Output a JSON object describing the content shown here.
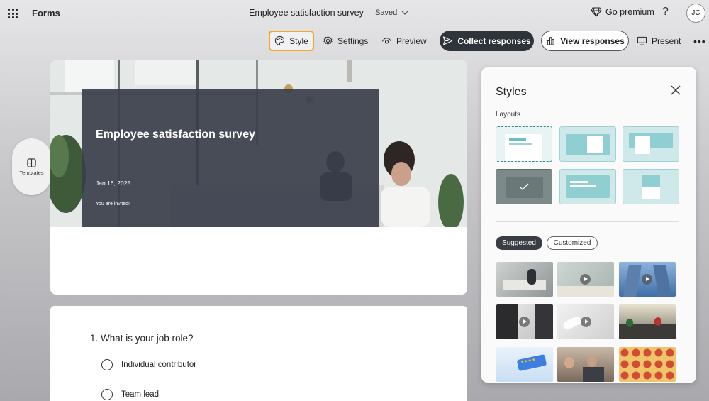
{
  "app": {
    "name": "Forms"
  },
  "document": {
    "title": "Employee satisfaction survey",
    "status": "Saved"
  },
  "header_right": {
    "premium_label": "Go premium",
    "help_symbol": "?",
    "avatar_initials": "JC"
  },
  "toolbar": {
    "style_label": "Style",
    "settings_label": "Settings",
    "preview_label": "Preview",
    "collect_label": "Collect responses",
    "view_label": "View responses",
    "present_label": "Present",
    "more_symbol": "•••"
  },
  "templates": {
    "label": "Templates"
  },
  "form_header": {
    "title": "Employee satisfaction survey",
    "date": "Jan 16, 2025",
    "invite": "You are invited!"
  },
  "question": {
    "text": "1. What is your job role?",
    "options": [
      "Individual contributor",
      "Team lead"
    ]
  },
  "styles_panel": {
    "title": "Styles",
    "layouts_label": "Layouts",
    "tabs": {
      "suggested": "Suggested",
      "customized": "Customized"
    }
  },
  "colors": {
    "accent_highlight": "#f5a623",
    "primary_button": "#2f333a",
    "header_overlay": "#3a3e4b",
    "layout_tile": "#cfe9ea"
  },
  "icons": [
    "waffle-icon",
    "chevron-down-icon",
    "diamond-icon",
    "palette-icon",
    "gear-icon",
    "eye-icon",
    "send-icon",
    "chart-icon",
    "monitor-icon",
    "templates-icon",
    "close-icon",
    "play-icon"
  ]
}
